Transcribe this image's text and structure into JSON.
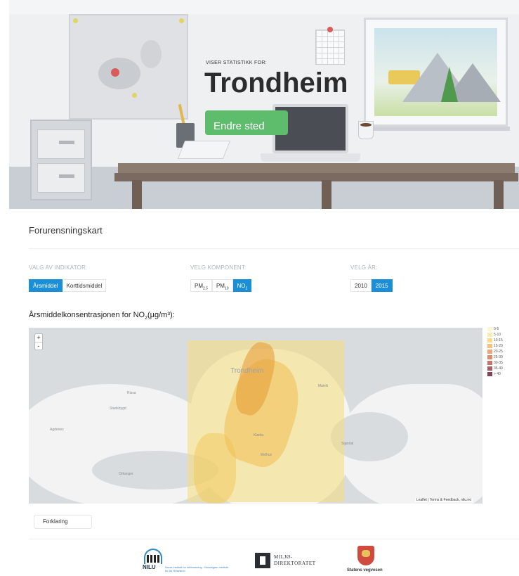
{
  "hero": {
    "overline": "VISER STATISTIKK FOR:",
    "city": "Trondheim",
    "change_button": "Endre sted"
  },
  "section": {
    "title": "Forurensningskart"
  },
  "controls": {
    "indicator": {
      "label": "VALG AV INDIKATOR:",
      "options": [
        "Årsmiddel",
        "Korttidsmiddel"
      ],
      "selected": "Årsmiddel"
    },
    "component": {
      "label": "VELG KOMPONENT:",
      "options": [
        {
          "base": "PM",
          "sub": "2.5"
        },
        {
          "base": "PM",
          "sub": "10"
        },
        {
          "base": "NO",
          "sub": "2"
        }
      ],
      "selected": "NO2"
    },
    "year": {
      "label": "VELG ÅR:",
      "options": [
        "2010",
        "2015"
      ],
      "selected": "2015"
    }
  },
  "map": {
    "title_prefix": "Årsmiddelkonsentrasjonen for NO",
    "title_sub": "2",
    "title_suffix": "(µg/m³):",
    "zoom_in": "+",
    "zoom_out": "-",
    "city_label": "Trondheim",
    "places": [
      "Rissa",
      "Stadsbygd",
      "Agdenes",
      "Orkanger",
      "Melhus",
      "Malvik",
      "Stjørdal",
      "Klæbu"
    ],
    "attribution": "Leaflet | Terms & Feedback, nilu.no"
  },
  "legend": {
    "items": [
      {
        "label": "0-5",
        "color": "#fdf6d8"
      },
      {
        "label": "5-10",
        "color": "#fbecb4"
      },
      {
        "label": "10-15",
        "color": "#f7dc8e"
      },
      {
        "label": "15-20",
        "color": "#f1c37c"
      },
      {
        "label": "20-25",
        "color": "#eaa878"
      },
      {
        "label": "25-30",
        "color": "#db8d73"
      },
      {
        "label": "30-35",
        "color": "#c6746d"
      },
      {
        "label": "35-40",
        "color": "#a55e62"
      },
      {
        "label": "> 40",
        "color": "#7d4453"
      }
    ]
  },
  "explain_button": "Forklaring",
  "footer": {
    "nilu": {
      "name": "NILU",
      "subtitle": "Norsk institutt for luftforskning · Norwegian Institute for Air Research"
    },
    "miljo": {
      "line1": "MILJØ-",
      "line2": "DIREKTORATET"
    },
    "vegvesen": {
      "name": "Statens vegvesen"
    }
  },
  "colors": {
    "accent": "#1a8fd8",
    "button_green": "#5dbd6c"
  }
}
